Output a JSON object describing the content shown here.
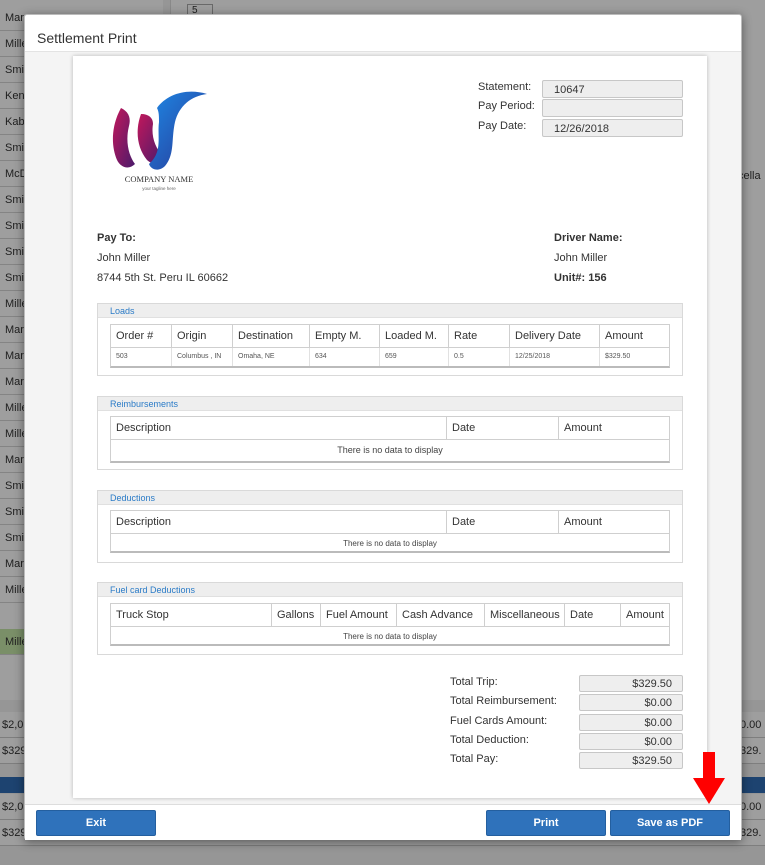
{
  "background": {
    "left_names": [
      "Mar",
      "Mille",
      "Smi",
      "Ken",
      "Kab",
      "Smi",
      "McD",
      "Smi",
      "Smi",
      "Smi",
      "Smi",
      "Mille",
      "Mar",
      "Mar",
      "Mar",
      "Mille",
      "Mille",
      "Mar",
      "Smi",
      "Smi",
      "Smi",
      "Mar",
      "Mille",
      "Mille"
    ],
    "pager_value": "5",
    "misc_fragment": "cella",
    "amount_left_1": "$2,0",
    "amount_left_2": "$329",
    "amount_right_1": "0.00",
    "amount_right_2": "329.",
    "amount_left_3": "$2,0",
    "amount_left_4": "$329",
    "amount_right_3": "0.00",
    "amount_right_4": "329."
  },
  "modal": {
    "title": "Settlement Print",
    "buttons": {
      "exit": "Exit",
      "print": "Print",
      "save_pdf": "Save as PDF"
    }
  },
  "logo": {
    "company_name": "COMPANY NAME",
    "tagline": "your tagline here"
  },
  "statement": {
    "labels": {
      "statement": "Statement:",
      "pay_period": "Pay Period:",
      "pay_date": "Pay Date:"
    },
    "statement_no": "10647",
    "pay_period": "",
    "pay_date": "12/26/2018"
  },
  "pay_to": {
    "label": "Pay To:",
    "name": "John Miller",
    "address": "8744 5th St. Peru IL 60662"
  },
  "driver": {
    "label": "Driver Name:",
    "name": "John Miller",
    "unit": "Unit#: 156"
  },
  "loads": {
    "title": "Loads",
    "columns": [
      "Order #",
      "Origin",
      "Destination",
      "Empty M.",
      "Loaded M.",
      "Rate",
      "Delivery Date",
      "Amount"
    ],
    "rows": [
      [
        "503",
        "Columbus , IN",
        "Omaha, NE",
        "634",
        "659",
        "0.5",
        "12/25/2018",
        "$329.50"
      ]
    ]
  },
  "reimbursements": {
    "title": "Reimbursements",
    "columns": [
      "Description",
      "Date",
      "Amount"
    ],
    "empty": "There is no data to display"
  },
  "deductions": {
    "title": "Deductions",
    "columns": [
      "Description",
      "Date",
      "Amount"
    ],
    "empty": "There is no data to display"
  },
  "fuel": {
    "title": "Fuel card Deductions",
    "columns": [
      "Truck Stop",
      "Gallons",
      "Fuel Amount",
      "Cash Advance",
      "Miscellaneous",
      "Date",
      "Amount"
    ],
    "empty": "There is no data to display"
  },
  "totals": {
    "labels": [
      "Total Trip:",
      "Total Reimbursement:",
      "Fuel Cards Amount:",
      "Total Deduction:",
      "Total Pay:"
    ],
    "values": [
      "$329.50",
      "$0.00",
      "$0.00",
      "$0.00",
      "$329.50"
    ]
  },
  "colors": {
    "accent": "#2f72bb",
    "section_title": "#2a7bc7",
    "arrow": "#ff0000",
    "selected_row": "#c6e7a8"
  }
}
